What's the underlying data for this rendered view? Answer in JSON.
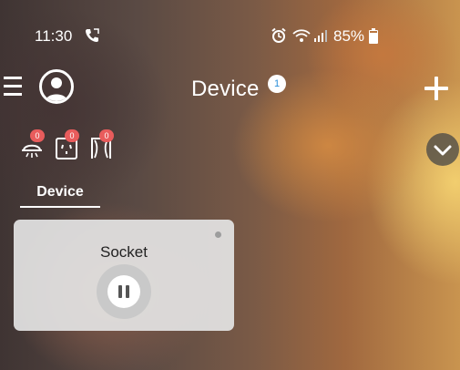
{
  "status_bar": {
    "time": "11:30",
    "battery": "85%",
    "icons": [
      "call-icon",
      "alarm-icon",
      "wifi-icon",
      "signal-icon",
      "battery-icon"
    ]
  },
  "header": {
    "title": "Device",
    "badge": "1",
    "menu_icon": "menu-icon",
    "avatar_icon": "user-avatar-icon",
    "add_icon": "plus-icon"
  },
  "filters": {
    "items": [
      {
        "icon": "ceiling-light-icon",
        "count": "0"
      },
      {
        "icon": "wall-socket-icon",
        "count": "0"
      },
      {
        "icon": "curtain-icon",
        "count": "0"
      }
    ],
    "collapse_icon": "chevron-down-icon"
  },
  "tabs": [
    {
      "label": "Device",
      "active": true
    }
  ],
  "devices": [
    {
      "name": "Socket",
      "status_icon": "pause-icon"
    }
  ],
  "colors": {
    "badge_red": "#e95c5c",
    "badge_blue_text": "#2b8fd9",
    "card_bg": "#e4e4e4"
  }
}
